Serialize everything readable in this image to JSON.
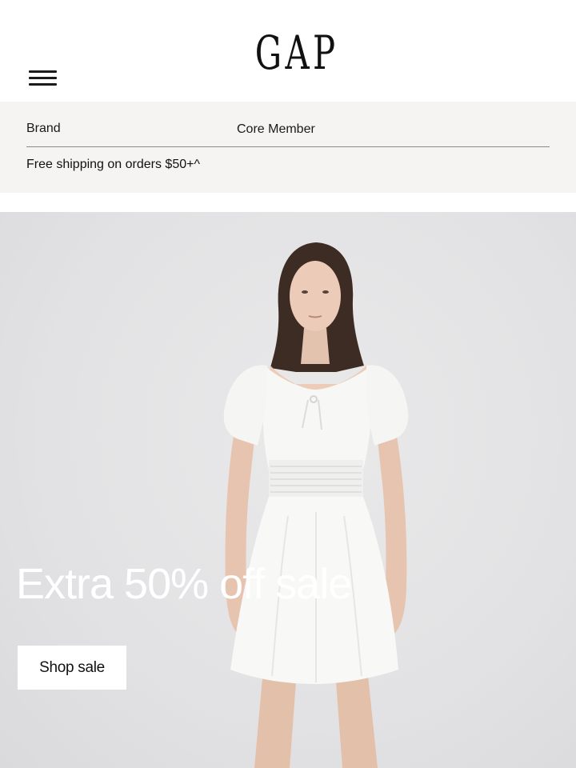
{
  "header": {
    "logo_text": "GAP",
    "menu_icon": "hamburger-menu-icon"
  },
  "promo_bar": {
    "brand_label": "Brand",
    "tier_label": "Core Member",
    "shipping_text": "Free shipping on orders $50+^"
  },
  "hero": {
    "headline": "Extra 50% off sale",
    "cta_label": "Shop sale",
    "image_subject": "model-in-white-puff-sleeve-dress"
  },
  "colors": {
    "promo_background": "#f5f4f2",
    "hero_background": "#e2e2e4",
    "headline_text": "#ffffff",
    "cta_background": "#ffffff"
  }
}
